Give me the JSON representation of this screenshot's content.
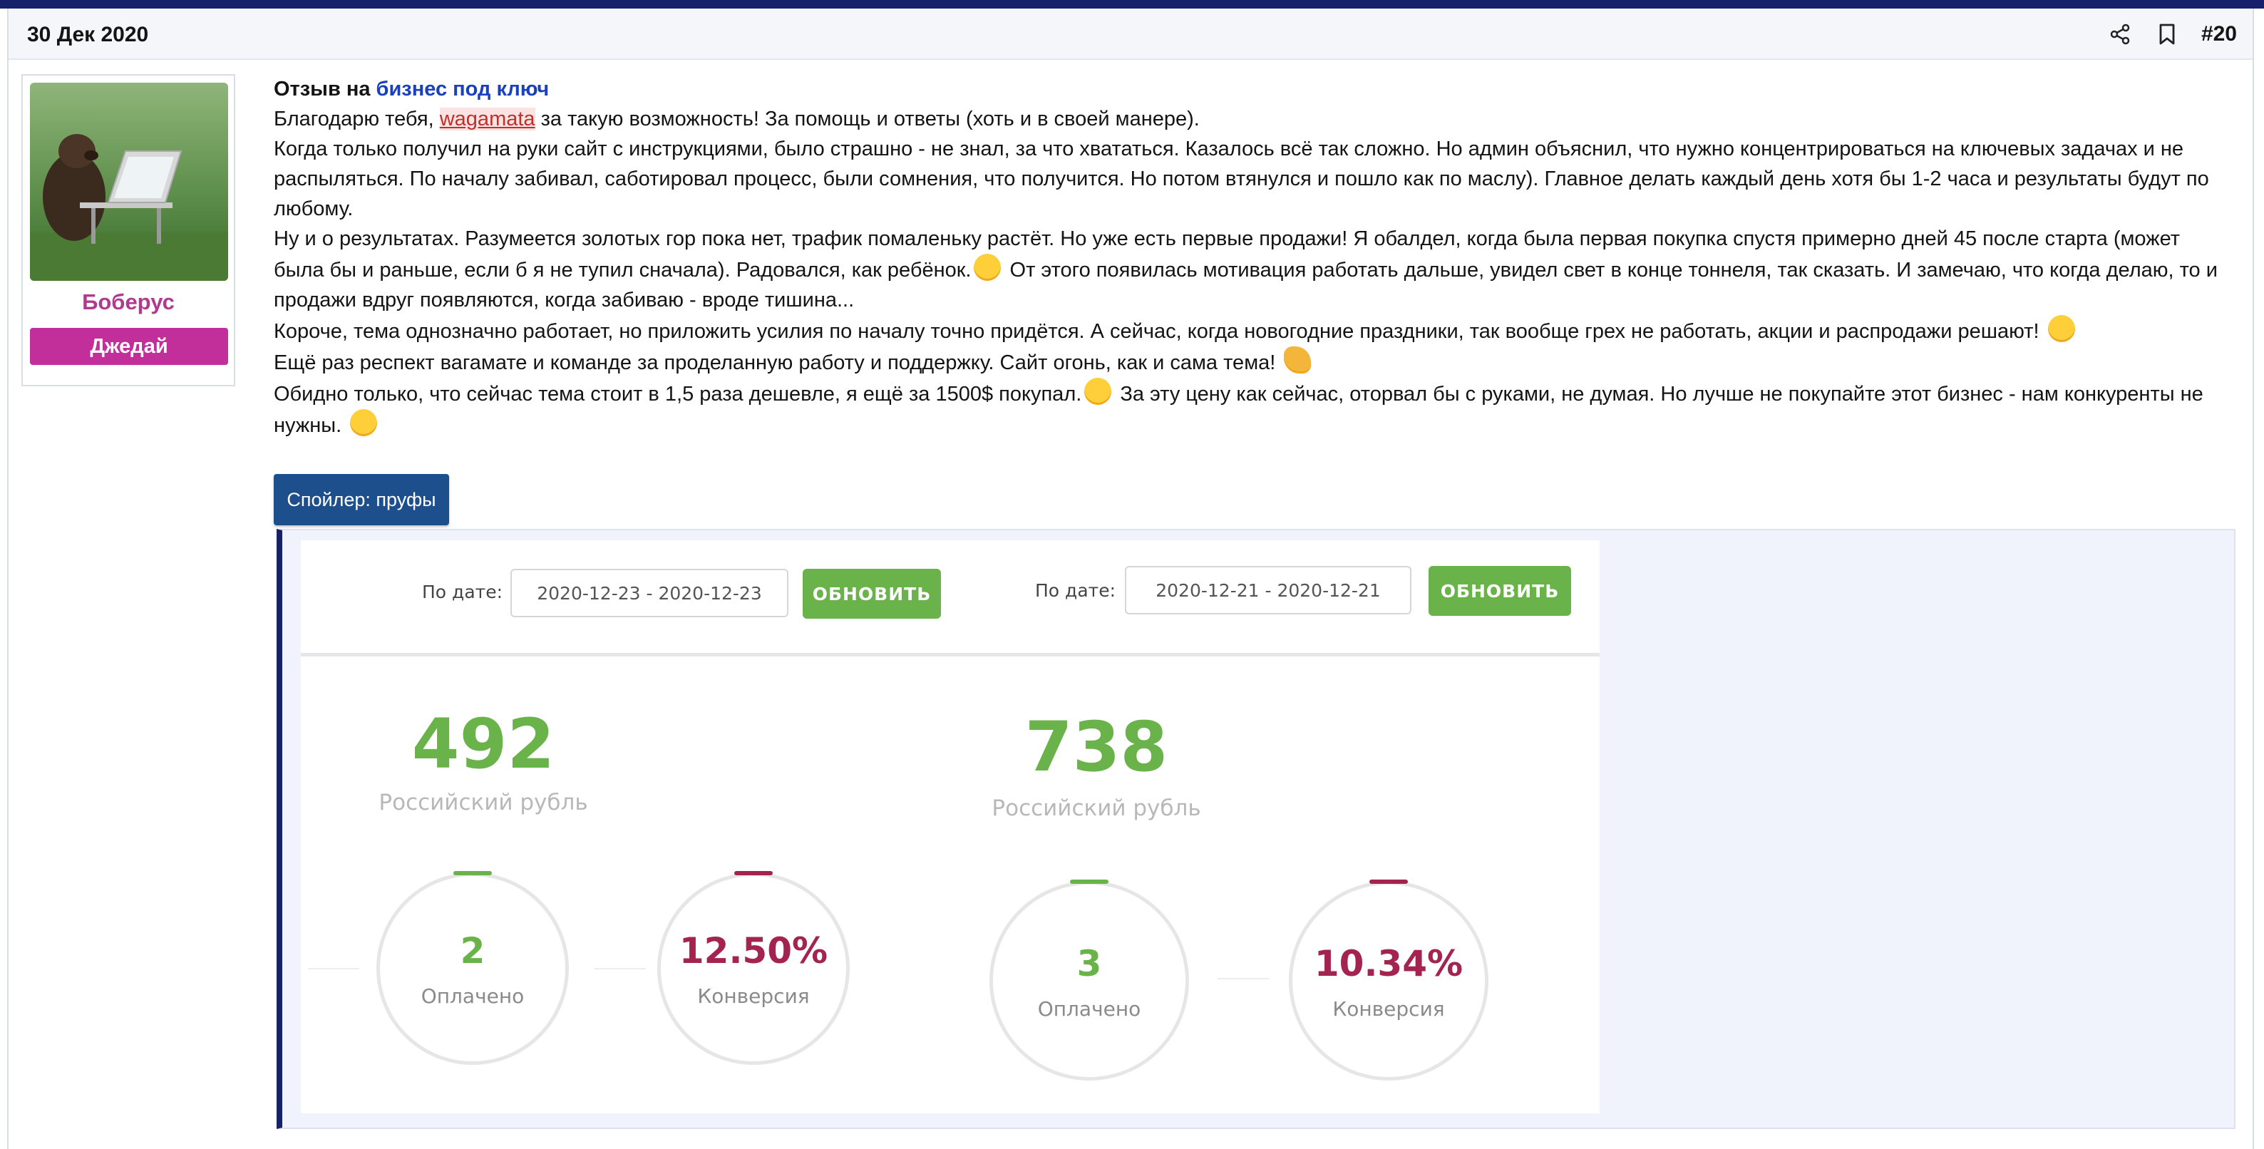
{
  "post": {
    "date": "30 Дек 2020",
    "number": "#20",
    "icons": [
      "share-icon",
      "bookmark-icon"
    ]
  },
  "user": {
    "name": "Боберус",
    "title": "Джедай"
  },
  "message": {
    "lead_prefix": "Отзыв на",
    "lead_link": "бизнес под ключ",
    "p1_before": "Благодарю тебя, ",
    "p1_mention": "wagamata",
    "p1_after": " за такую возможность! За помощь и ответы (хоть и в своей манере).",
    "p2": "Когда только получил на руки сайт с инструкциями, было страшно - не знал, за что хвататься. Казалось всё так сложно. Но админ объяснил, что нужно концентрироваться на ключевых задачах и не распыляться. По началу забивал, саботировал процесс, были сомнения, что получится. Но потом втянулся и пошло как по маслу). Главное делать каждый день хотя бы 1-2 часа и результаты будут по любому.",
    "p3_before": "Ну и о результатах. Разумеется золотых гор пока нет, трафик помаленьку растёт. Но уже есть первые продажи! Я обалдел, когда была первая покупка спустя примерно дней 45 после старта (может была бы и раньше, если б я не тупил сначала). Радовался, как ребёнок.",
    "p3_after": " От этого появилась мотивация работать дальше, увидел свет в конце тоннеля, так сказать. И замечаю, что когда делаю, то и продажи вдруг появляются, когда забиваю - вроде тишина...",
    "p4": "Короче, тема однозначно работает, но приложить усилия по началу точно придётся. А сейчас, когда новогодние праздники, так вообще грех не работать, акции и распродажи решают!",
    "p5": "Ещё раз респект вагамате и команде за проделанную работу и поддержку. Сайт огонь, как и сама тема!",
    "p6_before": "Обидно только, что сейчас тема стоит в 1,5 раза дешевле, я ещё за 1500$ покупал.",
    "p6_after": " За эту цену как сейчас, оторвал бы с руками, не думая. Но лучше не покупайте этот бизнес - нам конкуренты не нужны.",
    "emojis": [
      "grin-emoji",
      "shush-emoji",
      "handshake-emoji",
      "unamused-emoji",
      "upside-down-emoji"
    ]
  },
  "spoiler": {
    "label": "Спойлер: пруфы"
  },
  "stats": [
    {
      "date_label": "По дате:",
      "date_range": "2020-12-23 - 2020-12-23",
      "button": "ОБНОВИТЬ",
      "amount": "492",
      "currency": "Российский рубль",
      "paid_value": "2",
      "paid_label": "Оплачено",
      "conversion_value": "12.50%",
      "conversion_label": "Конверсия"
    },
    {
      "date_label": "По дате:",
      "date_range": "2020-12-21 - 2020-12-21",
      "button": "ОБНОВИТЬ",
      "amount": "738",
      "currency": "Российский рубль",
      "paid_value": "3",
      "paid_label": "Оплачено",
      "conversion_value": "10.34%",
      "conversion_label": "Конверсия"
    }
  ],
  "colors": {
    "header_bar": "#16206b",
    "username": "#b03a8f",
    "user_title_bg": "#c22f9a",
    "link": "#1a3fbf",
    "spoiler_button": "#1d4f8c",
    "green": "#6ab24a",
    "conversion": "#a3244f"
  }
}
